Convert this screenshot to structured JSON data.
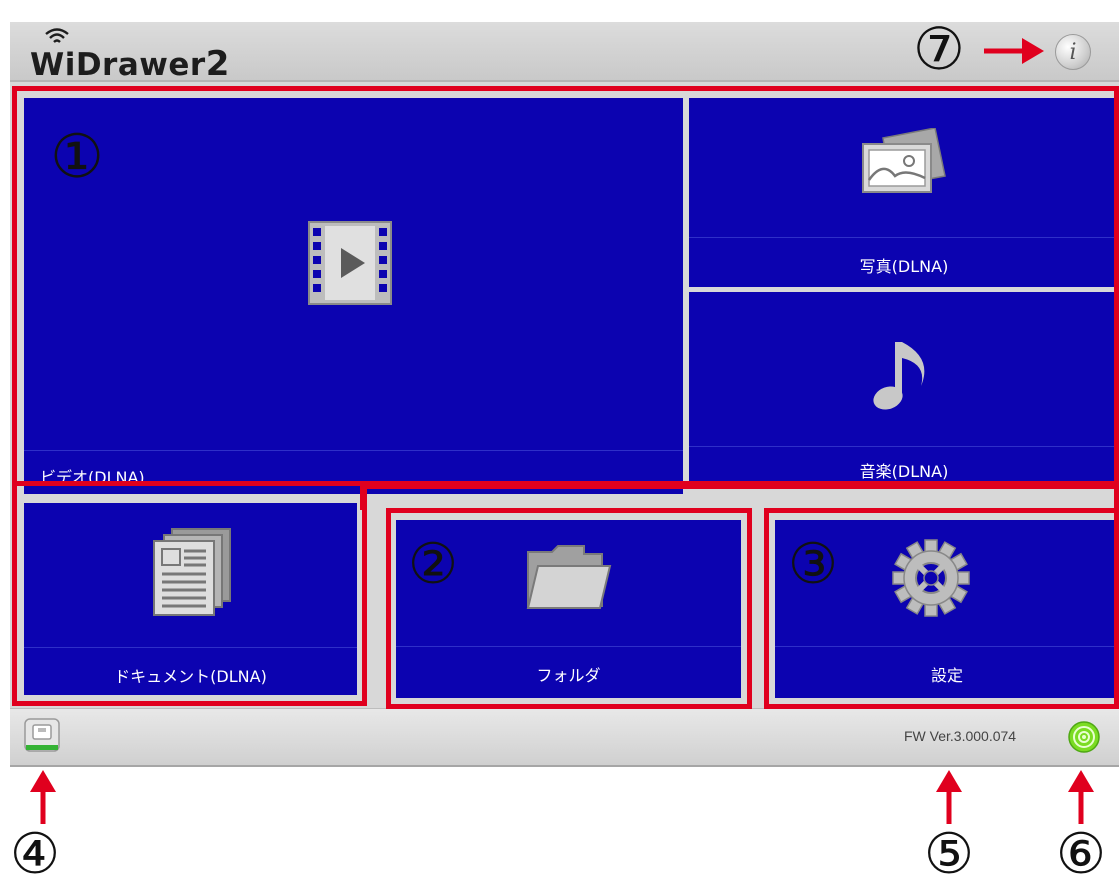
{
  "app": {
    "title": "WiDrawer",
    "title_suffix": "2",
    "info_glyph": "i"
  },
  "tiles": {
    "video": {
      "label": "ビデオ(DLNA)",
      "icon": "film-play-icon"
    },
    "photo": {
      "label": "写真(DLNA)",
      "icon": "photo-icon"
    },
    "music": {
      "label": "音楽(DLNA)",
      "icon": "music-note-icon"
    },
    "document": {
      "label": "ドキュメント(DLNA)",
      "icon": "document-stack-icon"
    },
    "folder": {
      "label": "フォルダ",
      "icon": "folder-icon"
    },
    "settings": {
      "label": "設定",
      "icon": "gear-icon"
    }
  },
  "statusbar": {
    "firmware": "FW Ver.3.000.074",
    "left_icon": "storage-icon",
    "right_icon": "wireless-signal-icon"
  },
  "callouts": {
    "c1": "①",
    "c2": "②",
    "c3": "③",
    "c4": "④",
    "c5": "⑤",
    "c6": "⑥",
    "c7": "⑦"
  },
  "colors": {
    "tile": "#0c03b0",
    "callout": "#e0001e",
    "chrome": "#d8d8d8"
  }
}
